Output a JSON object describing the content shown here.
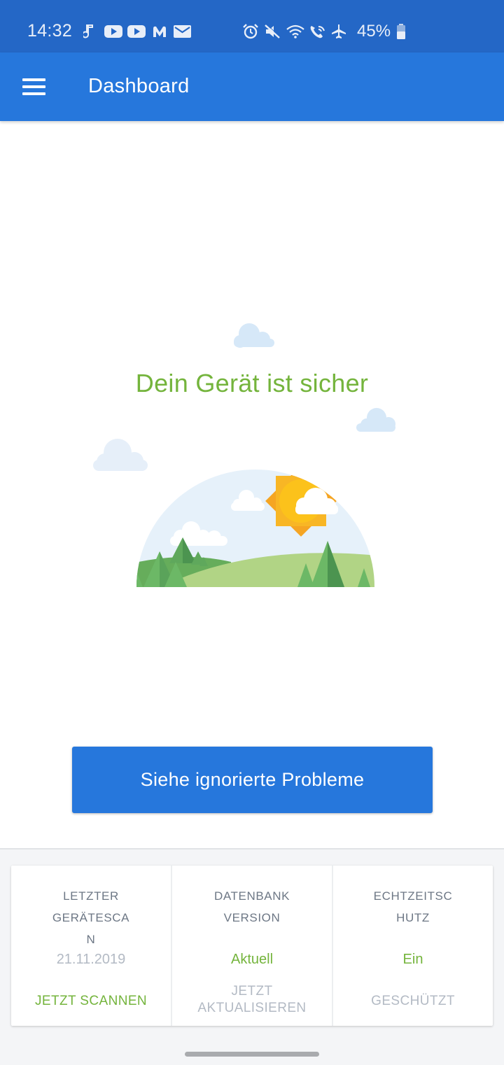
{
  "status_bar": {
    "time": "14:32",
    "battery": "45%",
    "icons_left": [
      "music-note-icon",
      "youtube-icon",
      "youtube-icon",
      "malwarebytes-icon",
      "mail-icon"
    ],
    "icons_right": [
      "alarm-icon",
      "mute-icon",
      "wifi-icon",
      "wifi-call-icon",
      "airplane-icon",
      "battery-icon"
    ]
  },
  "app_bar": {
    "title": "Dashboard",
    "menu_icon": "hamburger-menu-icon"
  },
  "main": {
    "headline": "Dein Gerät ist sicher",
    "button_label": "Siehe ignorierte Probleme"
  },
  "cards": [
    {
      "label": "LETZTER\nGERÄTESCA\nN",
      "value": "21.11.2019",
      "action": "JETZT SCANNEN"
    },
    {
      "label": "DATENBANK\nVERSION",
      "value": "Aktuell",
      "action": "JETZT\nAKTUALISIEREN"
    },
    {
      "label": "ECHTZEITSC\nHUTZ",
      "value": "Ein",
      "action": "GESCHÜTZT"
    }
  ],
  "colors": {
    "status_bar": "#2467c6",
    "app_bar": "#2677dc",
    "accent_green": "#74b43c",
    "muted_gray": "#b3bac4",
    "label_gray": "#6d7785"
  }
}
